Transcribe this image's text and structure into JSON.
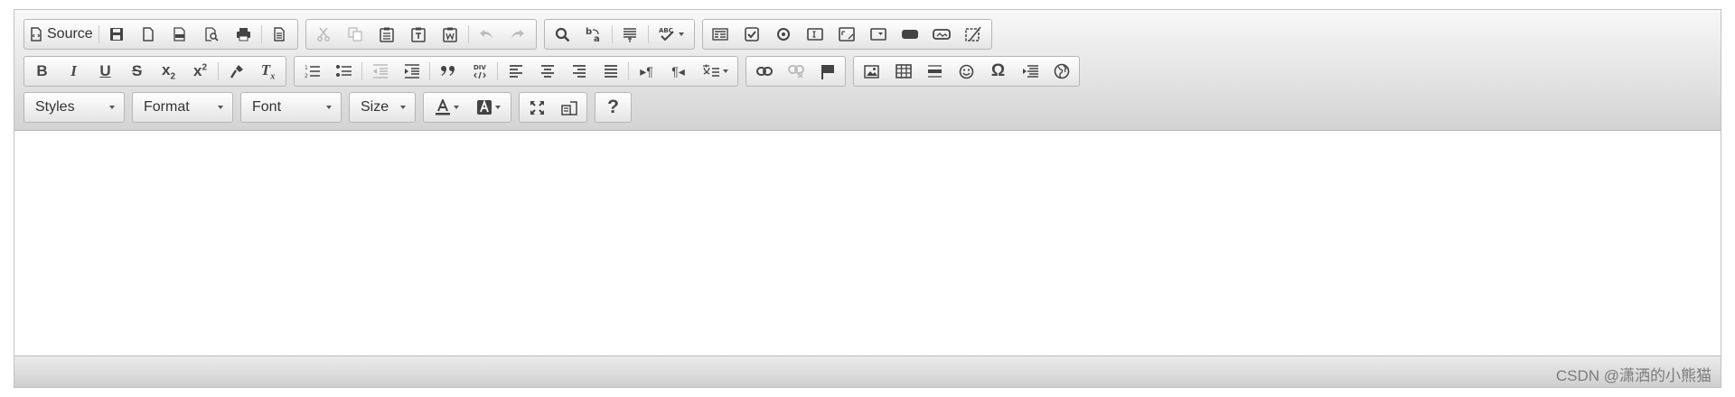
{
  "toolbar": {
    "source_label": "Source",
    "styles_label": "Styles",
    "format_label": "Format",
    "font_label": "Font",
    "size_label": "Size",
    "help_label": "?"
  },
  "footer": {
    "watermark": "CSDN @潇洒的小熊猫"
  },
  "icons": [
    "source-icon",
    "save-icon",
    "new-page-icon",
    "pdf-icon",
    "preview-icon",
    "print-icon",
    "templates-icon",
    "cut-icon",
    "copy-icon",
    "paste-icon",
    "paste-text-icon",
    "paste-word-icon",
    "undo-icon",
    "redo-icon",
    "find-icon",
    "replace-icon",
    "select-all-icon",
    "spellcheck-icon",
    "form-icon",
    "checkbox-icon",
    "radio-icon",
    "textfield-icon",
    "textarea-icon",
    "select-icon",
    "button-icon",
    "image-button-icon",
    "hidden-field-icon",
    "bold-icon",
    "italic-icon",
    "underline-icon",
    "strike-icon",
    "subscript-icon",
    "superscript-icon",
    "copy-format-icon",
    "remove-format-icon",
    "numbered-list-icon",
    "bulleted-list-icon",
    "outdent-icon",
    "indent-icon",
    "blockquote-icon",
    "div-icon",
    "align-left-icon",
    "align-center-icon",
    "align-right-icon",
    "justify-icon",
    "ltr-icon",
    "rtl-icon",
    "language-icon",
    "link-icon",
    "unlink-icon",
    "anchor-icon",
    "image-icon",
    "table-icon",
    "horizontal-rule-icon",
    "smiley-icon",
    "special-char-icon",
    "page-break-icon",
    "iframe-icon",
    "text-color-icon",
    "bg-color-icon",
    "maximize-icon",
    "show-blocks-icon",
    "help-icon"
  ]
}
